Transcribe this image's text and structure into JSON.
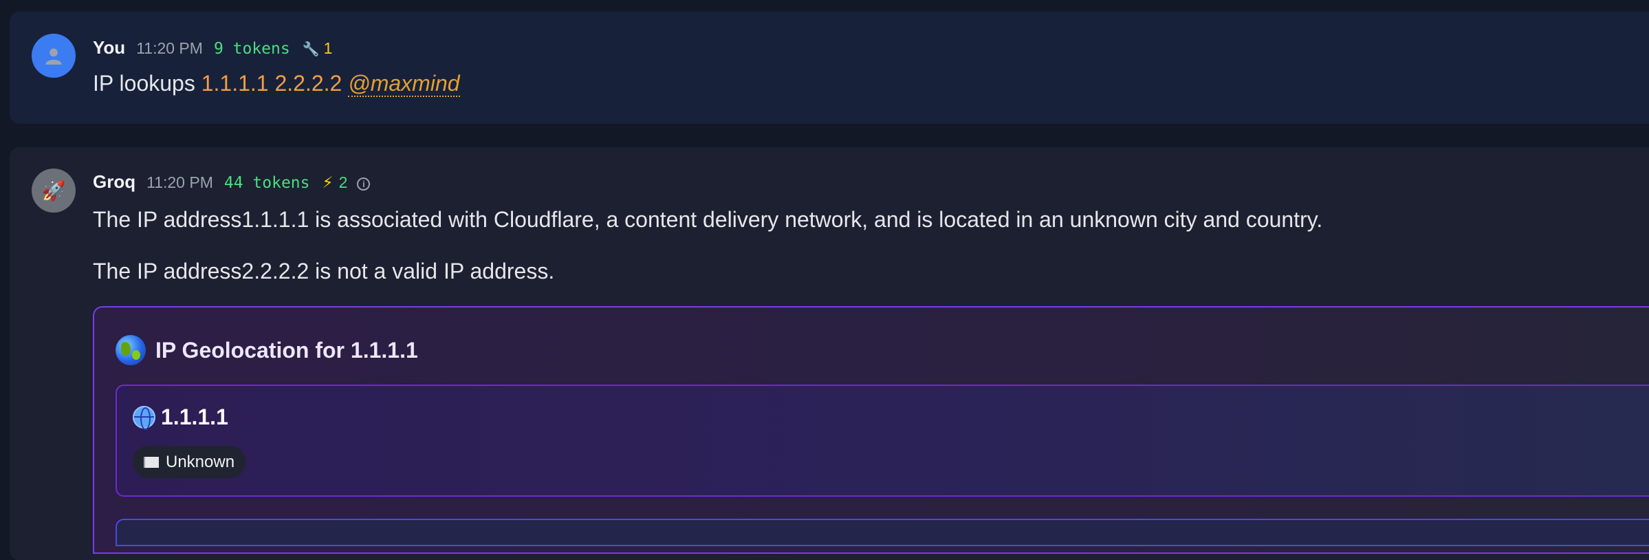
{
  "user_message": {
    "author": "You",
    "time": "11:20 PM",
    "tokens": "9 tokens",
    "tool_count": "1",
    "tool_icon": "wrench-icon",
    "text_prefix": "IP lookups",
    "ip1": "1.1.1.1",
    "ip2": "2.2.2.2",
    "mention": "@maxmind"
  },
  "bot_message": {
    "author": "Groq",
    "avatar_icon": "rocket-icon",
    "time": "11:20 PM",
    "tokens": "44 tokens",
    "bolt_count": "2",
    "paragraph1": "The IP address1.1.1.1 is associated with Cloudflare, a content delivery network, and is located in an unknown city and country.",
    "paragraph2": "The IP address2.2.2.2 is not a valid IP address."
  },
  "geo_card": {
    "title": "IP Geolocation for 1.1.1.1",
    "ip": "1.1.1.1",
    "country": "Unknown"
  },
  "colors": {
    "accent_ip": "#f59e42",
    "tokens": "#4ade80",
    "card_border": "#7c3aed"
  }
}
